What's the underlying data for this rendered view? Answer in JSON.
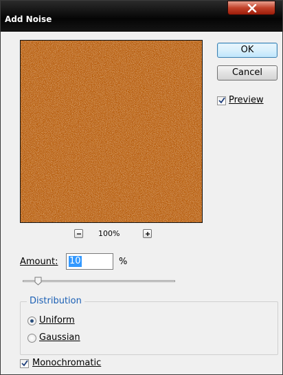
{
  "window": {
    "title": "Add Noise"
  },
  "buttons": {
    "ok": "OK",
    "cancel": "Cancel"
  },
  "preview_checkbox": {
    "label": "Preview",
    "checked": true
  },
  "zoom": {
    "level": "100%"
  },
  "amount": {
    "label": "Amount:",
    "value": "10",
    "unit": "%",
    "slider_fraction": 0.1
  },
  "distribution": {
    "legend": "Distribution",
    "options": [
      {
        "label": "Uniform",
        "selected": true
      },
      {
        "label": "Gaussian",
        "selected": false
      }
    ]
  },
  "monochromatic": {
    "label": "Monochromatic",
    "checked": true
  },
  "colors": {
    "noise_base": "#c0640c",
    "title_bar": "#0a0a0a",
    "close_button": "#c2412a",
    "legend_text": "#1a5fb4"
  }
}
